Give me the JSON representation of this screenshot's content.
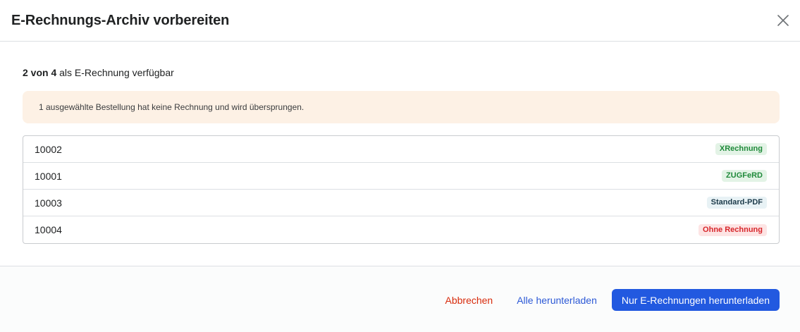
{
  "modal": {
    "title": "E-Rechnungs-Archiv vorbereiten",
    "close_icon": "close-icon"
  },
  "availability": {
    "count_bold": "2 von 4",
    "suffix": " als E-Rechnung verfügbar"
  },
  "notice": {
    "text": "1 ausgewählte Bestellung hat keine Rechnung und wird übersprungen."
  },
  "orders": [
    {
      "id": "10002",
      "badge": "XRechnung",
      "badge_tone": "green"
    },
    {
      "id": "10001",
      "badge": "ZUGFeRD",
      "badge_tone": "green"
    },
    {
      "id": "10003",
      "badge": "Standard-PDF",
      "badge_tone": "neutral"
    },
    {
      "id": "10004",
      "badge": "Ohne Rechnung",
      "badge_tone": "red"
    }
  ],
  "footer": {
    "cancel_label": "Abbrechen",
    "download_all_label": "Alle herunterladen",
    "download_einvoices_label": "Nur E-Rechnungen herunterladen"
  },
  "colors": {
    "primary": "#2259e0",
    "danger": "#d82c0d",
    "link": "#2c59d6",
    "notice_bg": "#fdf1e5"
  }
}
